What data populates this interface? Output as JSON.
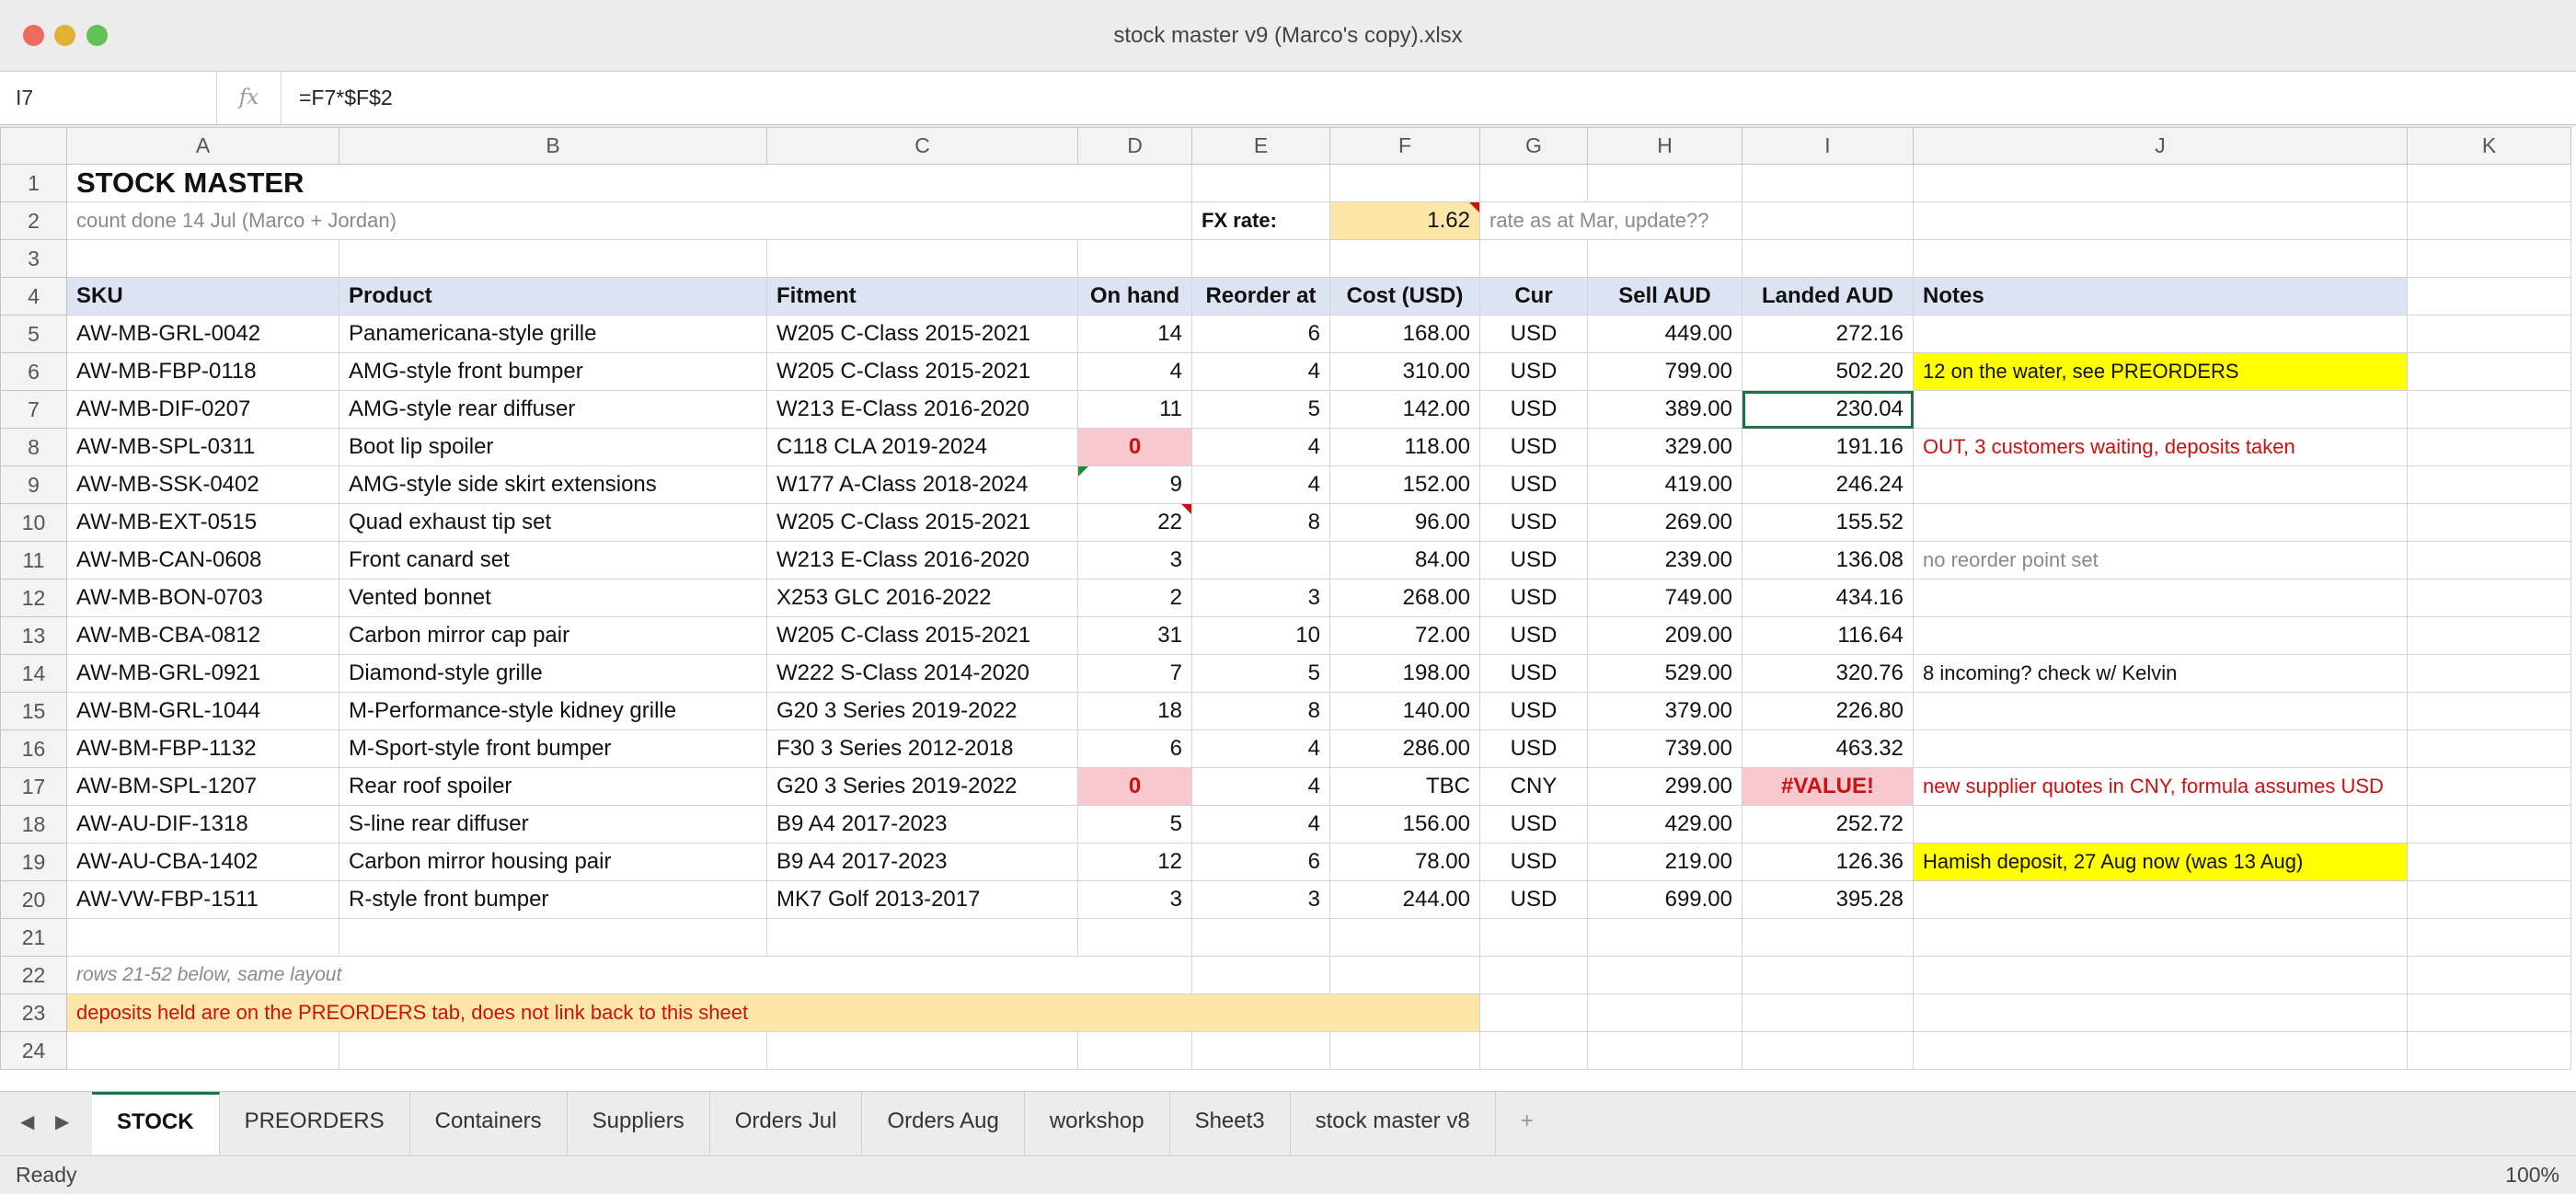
{
  "window": {
    "title": "stock master v9 (Marco's copy).xlsx",
    "traffic_lights": {
      "close": "#ed6a5e",
      "minimize": "#dfb236",
      "zoom": "#5fc454"
    }
  },
  "formula_bar": {
    "name_box": "I7",
    "fx_icon": "fx",
    "formula": "=F7*$F$2"
  },
  "columns": [
    "A",
    "B",
    "C",
    "D",
    "E",
    "F",
    "G",
    "H",
    "I",
    "J",
    "K"
  ],
  "sheet": {
    "title": "STOCK MASTER",
    "count_note": "count done 14 Jul (Marco + Jordan)",
    "fx_label": "FX rate:",
    "fx_value": "1.62",
    "fx_note": "rate as at Mar, update??",
    "headers": {
      "sku": "SKU",
      "product": "Product",
      "fitment": "Fitment",
      "on_hand": "On hand",
      "reorder_at": "Reorder at",
      "cost": "Cost (USD)",
      "cur": "Cur",
      "sell": "Sell AUD",
      "landed": "Landed AUD",
      "notes": "Notes"
    },
    "rows": [
      {
        "sku": "AW-MB-GRL-0042",
        "product": "Panamericana-style grille",
        "fitment": "W205 C-Class 2015-2021",
        "on_hand": "14",
        "reorder_at": "6",
        "cost": "168.00",
        "cur": "USD",
        "sell": "449.00",
        "landed": "272.16",
        "notes": ""
      },
      {
        "sku": "AW-MB-FBP-0118",
        "product": "AMG-style front bumper",
        "fitment": "W205 C-Class 2015-2021",
        "on_hand": "4",
        "reorder_at": "4",
        "cost": "310.00",
        "cur": "USD",
        "sell": "799.00",
        "landed": "502.20",
        "notes": "12 on the water, see PREORDERS"
      },
      {
        "sku": "AW-MB-DIF-0207",
        "product": "AMG-style rear diffuser",
        "fitment": "W213 E-Class 2016-2020",
        "on_hand": "11",
        "reorder_at": "5",
        "cost": "142.00",
        "cur": "USD",
        "sell": "389.00",
        "landed": "230.04",
        "notes": ""
      },
      {
        "sku": "AW-MB-SPL-0311",
        "product": "Boot lip spoiler",
        "fitment": "C118 CLA 2019-2024",
        "on_hand": "0",
        "reorder_at": "4",
        "cost": "118.00",
        "cur": "USD",
        "sell": "329.00",
        "landed": "191.16",
        "notes": "OUT, 3 customers waiting, deposits taken"
      },
      {
        "sku": "AW-MB-SSK-0402",
        "product": "AMG-style side skirt extensions",
        "fitment": "W177 A-Class 2018-2024",
        "on_hand": "9",
        "reorder_at": "4",
        "cost": "152.00",
        "cur": "USD",
        "sell": "419.00",
        "landed": "246.24",
        "notes": ""
      },
      {
        "sku": "AW-MB-EXT-0515",
        "product": "Quad exhaust tip set",
        "fitment": "W205 C-Class 2015-2021",
        "on_hand": "22",
        "reorder_at": "8",
        "cost": "96.00",
        "cur": "USD",
        "sell": "269.00",
        "landed": "155.52",
        "notes": ""
      },
      {
        "sku": "AW-MB-CAN-0608",
        "product": "Front canard set",
        "fitment": "W213 E-Class 2016-2020",
        "on_hand": "3",
        "reorder_at": "",
        "cost": "84.00",
        "cur": "USD",
        "sell": "239.00",
        "landed": "136.08",
        "notes": "no reorder point set"
      },
      {
        "sku": "AW-MB-BON-0703",
        "product": "Vented bonnet",
        "fitment": "X253 GLC 2016-2022",
        "on_hand": "2",
        "reorder_at": "3",
        "cost": "268.00",
        "cur": "USD",
        "sell": "749.00",
        "landed": "434.16",
        "notes": ""
      },
      {
        "sku": "AW-MB-CBA-0812",
        "product": "Carbon mirror cap pair",
        "fitment": "W205 C-Class 2015-2021",
        "on_hand": "31",
        "reorder_at": "10",
        "cost": "72.00",
        "cur": "USD",
        "sell": "209.00",
        "landed": "116.64",
        "notes": ""
      },
      {
        "sku": "AW-MB-GRL-0921",
        "product": "Diamond-style grille",
        "fitment": "W222 S-Class 2014-2020",
        "on_hand": "7",
        "reorder_at": "5",
        "cost": "198.00",
        "cur": "USD",
        "sell": "529.00",
        "landed": "320.76",
        "notes": "8 incoming? check w/ Kelvin"
      },
      {
        "sku": "AW-BM-GRL-1044",
        "product": "M-Performance-style kidney grille",
        "fitment": "G20 3 Series 2019-2022",
        "on_hand": "18",
        "reorder_at": "8",
        "cost": "140.00",
        "cur": "USD",
        "sell": "379.00",
        "landed": "226.80",
        "notes": ""
      },
      {
        "sku": "AW-BM-FBP-1132",
        "product": "M-Sport-style front bumper",
        "fitment": "F30 3 Series 2012-2018",
        "on_hand": "6",
        "reorder_at": "4",
        "cost": "286.00",
        "cur": "USD",
        "sell": "739.00",
        "landed": "463.32",
        "notes": ""
      },
      {
        "sku": "AW-BM-SPL-1207",
        "product": "Rear roof spoiler",
        "fitment": "G20 3 Series 2019-2022",
        "on_hand": "0",
        "reorder_at": "4",
        "cost": "TBC",
        "cur": "CNY",
        "sell": "299.00",
        "landed": "#VALUE!",
        "notes": "new supplier quotes in CNY, formula assumes USD"
      },
      {
        "sku": "AW-AU-DIF-1318",
        "product": "S-line rear diffuser",
        "fitment": "B9 A4 2017-2023",
        "on_hand": "5",
        "reorder_at": "4",
        "cost": "156.00",
        "cur": "USD",
        "sell": "429.00",
        "landed": "252.72",
        "notes": ""
      },
      {
        "sku": "AW-AU-CBA-1402",
        "product": "Carbon mirror housing pair",
        "fitment": "B9 A4 2017-2023",
        "on_hand": "12",
        "reorder_at": "6",
        "cost": "78.00",
        "cur": "USD",
        "sell": "219.00",
        "landed": "126.36",
        "notes": "Hamish deposit, 27 Aug now (was 13 Aug)"
      },
      {
        "sku": "AW-VW-FBP-1511",
        "product": "R-style front bumper",
        "fitment": "MK7 Golf 2013-2017",
        "on_hand": "3",
        "reorder_at": "3",
        "cost": "244.00",
        "cur": "USD",
        "sell": "699.00",
        "landed": "395.28",
        "notes": ""
      }
    ],
    "row22_note": "rows 21-52 below, same layout",
    "row23_banner": "deposits held are on the PREORDERS tab, does not link back to this sheet"
  },
  "tabs": [
    "STOCK",
    "PREORDERS",
    "Containers",
    "Suppliers",
    "Orders Jul",
    "Orders Aug",
    "workshop",
    "Sheet3",
    "stock master v8"
  ],
  "add_sheet": "+",
  "status": {
    "text": "Ready",
    "zoom": "100%"
  },
  "colors": {
    "accent": "#1e7145",
    "header_fill": "#dce3f2",
    "error_fill": "#f9c8ce",
    "note_yellow": "#ffff00",
    "banner_fill": "#fde7a8",
    "error_red": "#cc1111"
  }
}
